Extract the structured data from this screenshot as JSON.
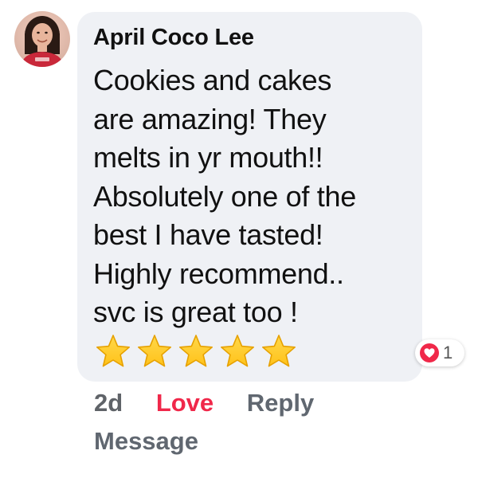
{
  "comment": {
    "author": "April Coco Lee",
    "lines": [
      "Cookies and cakes",
      "are amazing! They",
      "melts in yr mouth!!",
      "Absolutely one of the",
      "best I have tasted!",
      "Highly recommend..",
      "svc is great too !"
    ],
    "rating_stars": 5,
    "reaction": {
      "icon": "heart-icon",
      "count": "1",
      "color": "#f02849"
    }
  },
  "actions": {
    "time": "2d",
    "love_label": "Love",
    "reply_label": "Reply",
    "message_label": "Message"
  },
  "colors": {
    "bubble": "#eff1f5",
    "love": "#f0284a",
    "action_gray": "#606770",
    "star": "#ffc21a"
  }
}
